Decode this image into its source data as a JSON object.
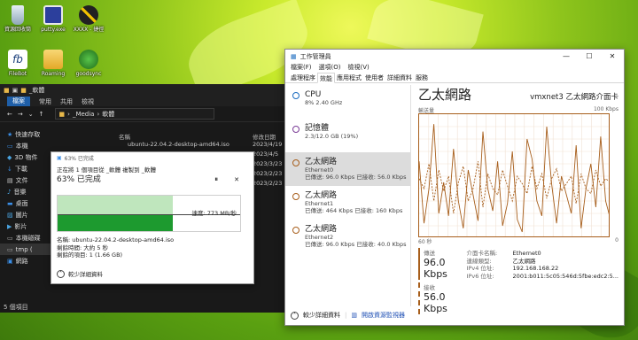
{
  "desktop": {
    "icons": [
      {
        "label": "資源回收筒",
        "icon": "recycle-bin-icon"
      },
      {
        "label": "putty.exe",
        "icon": "putty-icon"
      },
      {
        "label": "XXXX - 捷徑",
        "icon": "shortcut-icon"
      },
      {
        "label": "FileBot",
        "icon": "filebot-icon"
      },
      {
        "label": "Roaming",
        "icon": "folder-icon"
      },
      {
        "label": "goodsync",
        "icon": "goodsync-icon"
      }
    ]
  },
  "explorer": {
    "title": "_軟體",
    "ribbon_tabs": [
      "檔案",
      "常用",
      "共用",
      "檢視"
    ],
    "address": [
      "_Media",
      "軟體"
    ],
    "sidebar": [
      "快速存取",
      "本機",
      "3D 物件",
      "下載",
      "文件",
      "音樂",
      "桌面",
      "圖片",
      "影片",
      "本機磁碟",
      "tmp (",
      "網路"
    ],
    "columns": {
      "name": "名稱",
      "date": "修改日期"
    },
    "files": [
      {
        "name": "ubuntu-22.04.2-desktop-amd64.iso",
        "date": "2023/4/19"
      },
      {
        "name": "",
        "date": "2023/4/5"
      },
      {
        "name": "",
        "date": "2023/3/23"
      },
      {
        "name": "",
        "date": "2023/2/23"
      },
      {
        "name": "",
        "date": "2023/2/23"
      }
    ],
    "status": "5 個項目"
  },
  "copy_dialog": {
    "title": "63% 已完成",
    "desc": "正在將 1 個項目從 _軟體 複製到 _軟體",
    "percent_text": "63% 已完成",
    "progress": 0.63,
    "speed": "速度: 773 MB/秒",
    "name_line": "名稱: ubuntu-22.04.2-desktop-amd64.iso",
    "remaining_time": "剩餘時間: 大約 5 秒",
    "remaining_items": "剩餘的項目: 1 (1.66 GB)",
    "less_details": "較少詳細資料",
    "pause": "⏸",
    "close": "✕"
  },
  "task_manager": {
    "title": "工作管理員",
    "menu": [
      "檔案(F)",
      "選項(O)",
      "檢視(V)"
    ],
    "tabs": [
      "處理程序",
      "效能",
      "應用程式",
      "使用者",
      "詳細資料",
      "服務"
    ],
    "active_tab": "效能",
    "resources": [
      {
        "name": "CPU",
        "sub1": "8% 2.40 GHz",
        "sub2": "",
        "color": "#1a6bbf"
      },
      {
        "name": "記憶體",
        "sub1": "2.3/12.0 GB (19%)",
        "sub2": "",
        "color": "#7a3b96"
      },
      {
        "name": "乙太網路",
        "sub1": "Ethernet0",
        "sub2": "已傳送: 96.0 Kbps 已接收: 56.0 Kbps",
        "color": "#a75e1b"
      },
      {
        "name": "乙太網路",
        "sub1": "Ethernet1",
        "sub2": "已傳送: 464 Kbps 已接收: 160 Kbps",
        "color": "#a75e1b"
      },
      {
        "name": "乙太網路",
        "sub1": "Ethernet2",
        "sub2": "已傳送: 96.0 Kbps 已接收: 40.0 Kbps",
        "color": "#a75e1b"
      }
    ],
    "detail": {
      "heading": "乙太網路",
      "adapter": "vmxnet3 乙太網路介面卡",
      "chart_label": "輸送量",
      "chart_max": "100 Kbps",
      "time_label": "60 秒",
      "zero_label": "0",
      "send_label": "傳送",
      "send_value": "96.0 Kbps",
      "recv_label": "接收",
      "recv_value": "56.0 Kbps",
      "props": [
        {
          "k": "介面卡名稱:",
          "v": "Ethernet0"
        },
        {
          "k": "連線類型:",
          "v": "乙太網路"
        },
        {
          "k": "IPv4 位址:",
          "v": "192.168.168.22"
        },
        {
          "k": "IPv6 位址:",
          "v": "2001:b011:5c05:546d:5fbe:edc2:5..."
        }
      ]
    },
    "less_details": "較少詳細資料",
    "open_monitor": "開啟資源監視器"
  },
  "chart_data": {
    "type": "line",
    "title": "",
    "xlabel": "60 秒",
    "ylabel": "輸送量",
    "ylim": [
      0,
      100
    ],
    "series": [
      {
        "name": "傳送",
        "color": "#a75e1b",
        "values": [
          62,
          12,
          40,
          92,
          20,
          45,
          18,
          72,
          30,
          8,
          55,
          35,
          14,
          86,
          40,
          22,
          62,
          10,
          28,
          70,
          15,
          5,
          80,
          64,
          30,
          18,
          90,
          44,
          12,
          50,
          35,
          20,
          75,
          8,
          40,
          60,
          25,
          82,
          30,
          15
        ]
      },
      {
        "name": "接收",
        "color": "#a75e1b",
        "values": [
          48,
          40,
          60,
          30,
          55,
          38,
          50,
          20,
          45,
          58,
          30,
          40,
          62,
          25,
          52,
          40,
          35,
          55,
          42,
          30,
          50,
          44,
          36,
          58,
          40,
          52,
          32,
          48,
          56,
          38,
          44,
          50,
          28,
          52,
          40,
          36,
          55,
          42,
          48,
          45
        ]
      }
    ]
  }
}
